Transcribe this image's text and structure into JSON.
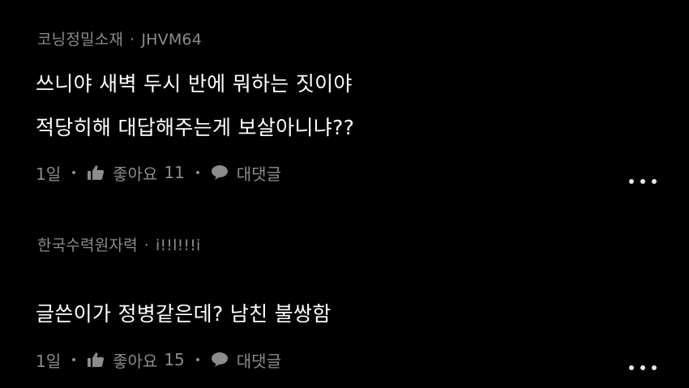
{
  "comments": [
    {
      "nickname": "코닝정밀소재",
      "separator": "·",
      "username": "JHVM64",
      "lines": [
        "쓰니야 새벽 두시 반에 뭐하는 짓이야",
        "적당히해 대답해주는게 보살아니냐??"
      ],
      "time": "1일",
      "like_label": "좋아요",
      "like_count": "11",
      "reply_label": "대댓글"
    },
    {
      "nickname": "한국수력원자력",
      "separator": "·",
      "username": "i!!l!!!i",
      "lines": [
        "글쓴이가 정병같은데? 남친 불쌍함"
      ],
      "time": "1일",
      "like_label": "좋아요",
      "like_count": "15",
      "reply_label": "대댓글"
    }
  ],
  "icons": {
    "like": "thumbs-up-icon",
    "reply": "speech-bubble-icon",
    "more": "more-dots-icon"
  },
  "colors": {
    "background": "#000000",
    "text_primary": "#ffffff",
    "text_secondary": "#8c8c8c"
  }
}
